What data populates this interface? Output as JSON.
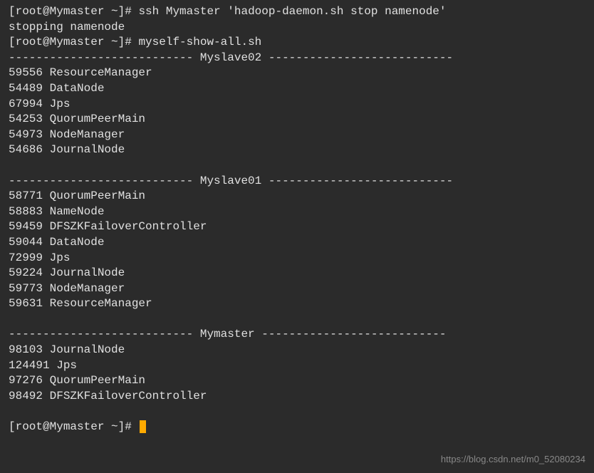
{
  "prompt1": {
    "full": "[root@Mymaster ~]# ",
    "command": "ssh Mymaster 'hadoop-daemon.sh stop namenode'"
  },
  "output1": "stopping namenode",
  "prompt2": {
    "full": "[root@Mymaster ~]# ",
    "command": "myself-show-all.sh"
  },
  "section1": {
    "header": "--------------------------- Myslave02 ---------------------------",
    "lines": [
      "59556 ResourceManager",
      "54489 DataNode",
      "67994 Jps",
      "54253 QuorumPeerMain",
      "54973 NodeManager",
      "54686 JournalNode"
    ]
  },
  "section2": {
    "header": "--------------------------- Myslave01 ---------------------------",
    "lines": [
      "58771 QuorumPeerMain",
      "58883 NameNode",
      "59459 DFSZKFailoverController",
      "59044 DataNode",
      "72999 Jps",
      "59224 JournalNode",
      "59773 NodeManager",
      "59631 ResourceManager"
    ]
  },
  "section3": {
    "header": "--------------------------- Mymaster ---------------------------",
    "lines": [
      "98103 JournalNode",
      "124491 Jps",
      "97276 QuorumPeerMain",
      "98492 DFSZKFailoverController"
    ]
  },
  "prompt3": {
    "full": "[root@Mymaster ~]# "
  },
  "watermark": "https://blog.csdn.net/m0_52080234"
}
